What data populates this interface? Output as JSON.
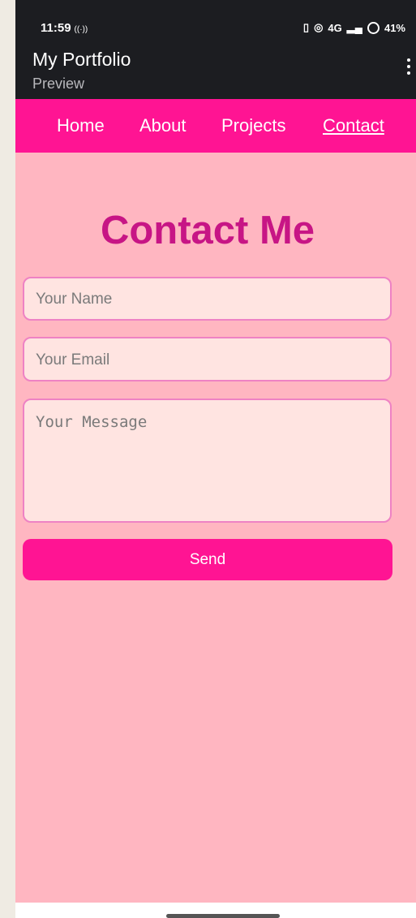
{
  "status": {
    "time": "11:59",
    "battery": "41%",
    "network": "4G"
  },
  "app": {
    "title": "My Portfolio",
    "subtitle": "Preview"
  },
  "nav": {
    "items": [
      "Home",
      "About",
      "Projects",
      "Contact"
    ],
    "active": "Contact"
  },
  "page": {
    "heading": "Contact Me",
    "name_placeholder": "Your Name",
    "email_placeholder": "Your Email",
    "message_placeholder": "Your Message",
    "send_label": "Send"
  },
  "colors": {
    "background": "#ffb6c1",
    "nav": "#ff1493",
    "heading": "#c71585",
    "field_bg": "#ffe4e1",
    "field_border": "#ee82c4",
    "appbar": "#1c1d21"
  }
}
